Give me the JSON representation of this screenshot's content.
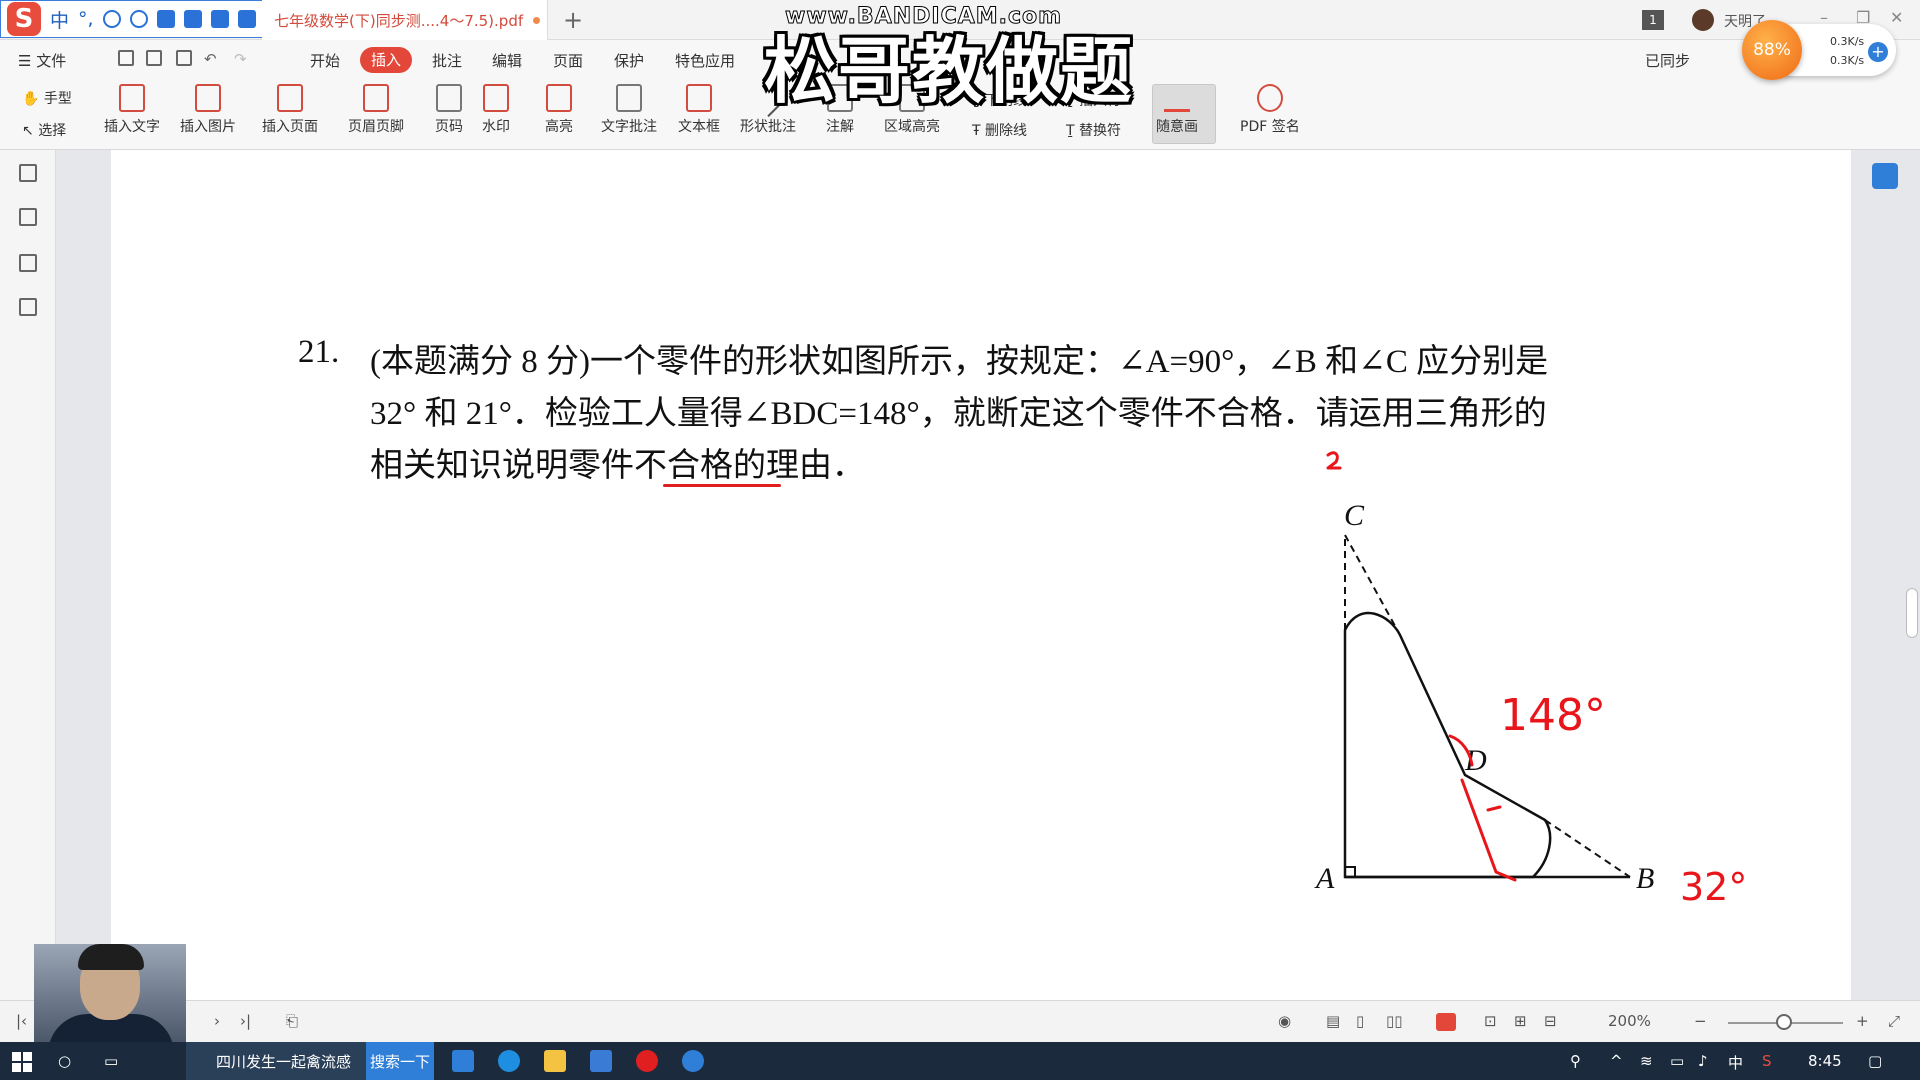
{
  "ime": {
    "logo": "S",
    "lang": "中",
    "punct": "°,"
  },
  "window": {
    "tab_title": "七年级数学(下)同步测....4～7.5).pdf",
    "new_tab": "+",
    "page_badge": "1",
    "user_name": "天明了",
    "min": "–",
    "max": "❐",
    "close": "✕"
  },
  "menu": {
    "file": "☰ 文件",
    "tabs": [
      "开始",
      "插入",
      "批注",
      "编辑",
      "页面",
      "保护",
      "特色应用"
    ],
    "sync": "已同步"
  },
  "ribbon": {
    "hand": "手型",
    "select": "选择",
    "insert_text": "插入文字",
    "insert_image": "插入图片",
    "insert_page": "插入页面",
    "header_footer": "页眉页脚",
    "page_number": "页码",
    "watermark": "水印",
    "highlight": "高亮",
    "text_annot": "文字批注",
    "textbox": "文本框",
    "shape_annot": "形状批注",
    "note": "注解",
    "area_highlight": "区域高亮",
    "underline": "下划线",
    "strikethrough": "删除线",
    "insert_mark": "插入符",
    "replace_mark": "替换符",
    "freehand": "随意画",
    "pdf_sign": "PDF 签名"
  },
  "question": {
    "number": "21.",
    "line1": "(本题满分 8 分)一个零件的形状如图所示，按规定：∠A=90°，∠B 和∠C 应分别是",
    "line2": "32° 和 21°．检验工人量得∠BDC=148°，就断定这个零件不合格．请运用三角形的",
    "line3": "相关知识说明零件不合格的理由．"
  },
  "figure": {
    "label_c": "C",
    "label_d": "D",
    "label_a": "A",
    "label_b": "B",
    "hand_148": "148°",
    "hand_32": "32°",
    "hand_2": "2"
  },
  "overlay": {
    "watermark_url": "www.BANDICAM.com",
    "title": "松哥教做题",
    "net_percent": "88%",
    "net_up": "0.3K/s",
    "net_down": "0.3K/s"
  },
  "statusbar": {
    "zoom": "200%"
  },
  "taskbar": {
    "news": "四川发生一起禽流感",
    "search": "搜索一下",
    "lang": "中",
    "time": "8:45"
  },
  "colors": {
    "accent_red": "#e2473a",
    "handwriting_red": "#e8151a",
    "taskbar": "#1b2b3d",
    "highlight_blue": "#2f7fd8"
  }
}
